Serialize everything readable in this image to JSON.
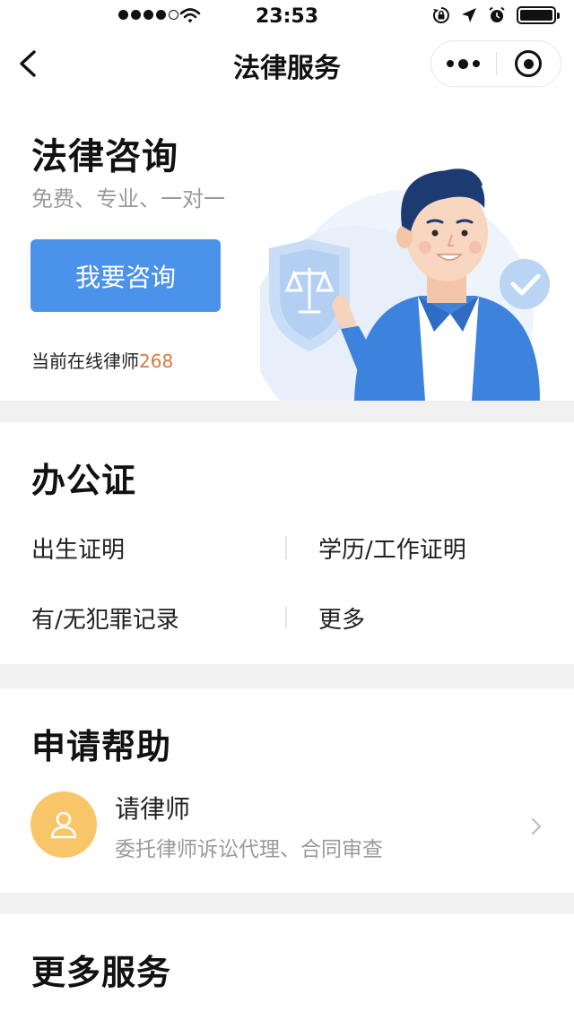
{
  "status_bar": {
    "time": "23:53"
  },
  "nav": {
    "title": "法律服务"
  },
  "consult": {
    "title": "法律咨询",
    "subtitle": "免费、专业、一对一",
    "button_label": "我要咨询",
    "online_label": "当前在线律师",
    "online_count": "268"
  },
  "certificates": {
    "title": "办公证",
    "items": [
      "出生证明",
      "学历/工作证明",
      "有/无犯罪记录",
      "更多"
    ]
  },
  "help": {
    "title": "申请帮助",
    "item": {
      "title": "请律师",
      "desc": "委托律师诉讼代理、合同审查"
    }
  },
  "more_services": {
    "title": "更多服务"
  },
  "colors": {
    "accent": "#4b93ea",
    "count": "#e0763c",
    "avatar_bg": "#f8c569",
    "section_gap": "#f1f1f1"
  },
  "icons": [
    "signal-dots-icon",
    "wifi-icon",
    "lock-rotation-icon",
    "location-arrow-icon",
    "alarm-icon",
    "battery-icon",
    "back-arrow-icon",
    "more-dots-icon",
    "close-mini-program-icon",
    "person-icon",
    "chevron-right-icon"
  ]
}
